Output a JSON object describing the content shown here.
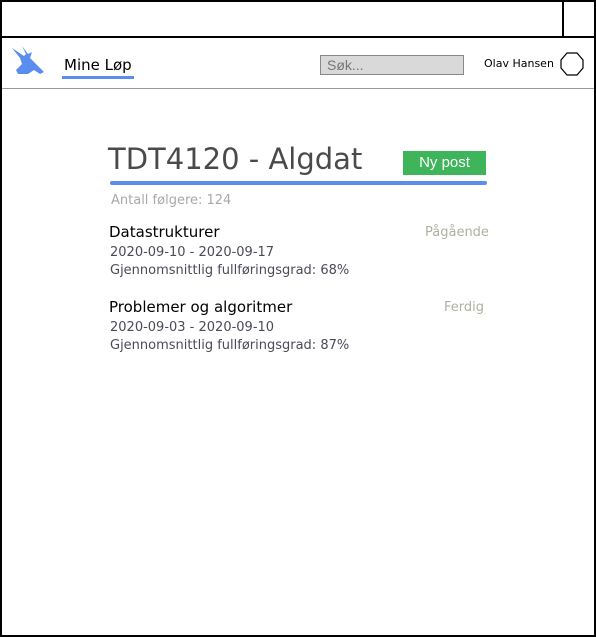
{
  "navbar": {
    "nav_link": "Mine Løp",
    "search_placeholder": "Søk...",
    "username": "Olav Hansen"
  },
  "course": {
    "title": "TDT4120 - Algdat",
    "new_post_label": "Ny post",
    "followers": "Antall følgere: 124"
  },
  "posts": [
    {
      "title": "Datastrukturer",
      "status": "Pågående",
      "dates": "2020-09-10 - 2020-09-17",
      "grade": "Gjennomsnittlig fullføringsgrad: 68%"
    },
    {
      "title": "Problemer og algoritmer",
      "status": "Ferdig",
      "dates": "2020-09-03 - 2020-09-10",
      "grade": "Gjennomsnittlig fullføringsgrad: 87%"
    }
  ],
  "colors": {
    "accent": "#5b8def",
    "button": "#3eb55a",
    "status": "#b0b0a0"
  },
  "icons": {
    "logo": "antelope-logo-icon",
    "avatar": "hexagon-avatar-icon"
  }
}
